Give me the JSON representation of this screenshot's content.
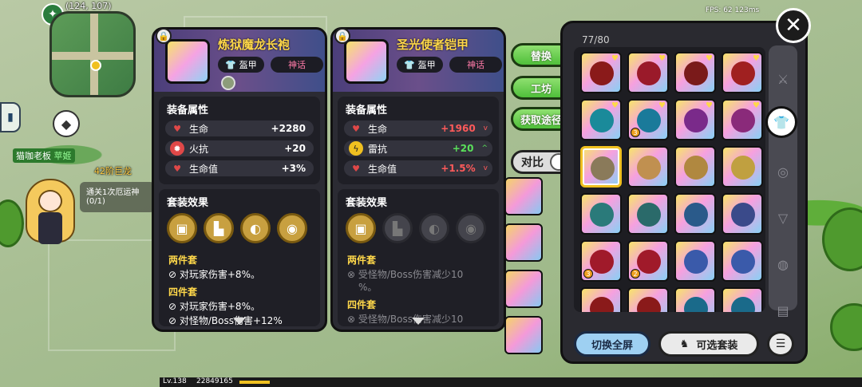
{
  "hud": {
    "coords": "(124, 107)",
    "fps": "FPS: 62 123ms",
    "level": "Lv.138",
    "xp": "22849165",
    "xp_fraction": 0.05
  },
  "world": {
    "npc_name": "猫咖老板",
    "npc_village": "苹姬",
    "boss_label": "42阶巨龙",
    "quest_title": "通关1次厄运神",
    "quest_progress": "(0/1)"
  },
  "left_card": {
    "title": "炼狱魔龙长袍",
    "type": "盔甲",
    "rarity": "神话",
    "level_badge": "6",
    "attr_title": "装备属性",
    "stats": [
      {
        "name": "生命",
        "value": "+2280",
        "icon": "heart-icon",
        "color": "#e04848"
      },
      {
        "name": "火抗",
        "value": "+20",
        "icon": "fire-resist-icon",
        "color": "#e04848"
      },
      {
        "name": "生命值",
        "value": "+3%",
        "icon": "heart-icon",
        "color": "#e04848"
      }
    ],
    "set_title": "套装效果",
    "set_two": "两件套",
    "set_two_effect": "对玩家伤害+8%。",
    "set_four": "四件套",
    "set_four_effect": "对玩家伤害+8%。",
    "set_four_effect2": "对怪物/Boss伤害+12%"
  },
  "right_card": {
    "title": "圣光使者铠甲",
    "type": "盔甲",
    "rarity": "神话",
    "attr_title": "装备属性",
    "stats": [
      {
        "name": "生命",
        "value": "+1960",
        "icon": "heart-icon",
        "color": "#e04848",
        "trend": "red",
        "arrow": "v"
      },
      {
        "name": "雷抗",
        "value": "+20",
        "icon": "thunder-resist-icon",
        "color": "#f0c020",
        "trend": "green",
        "arrow": "^"
      },
      {
        "name": "生命值",
        "value": "+1.5%",
        "icon": "heart-icon",
        "color": "#e04848",
        "trend": "red",
        "arrow": "v"
      }
    ],
    "set_title": "套装效果",
    "set_two": "两件套",
    "set_two_effect": "受怪物/Boss伤害减少10",
    "set_two_effect_cont": "%。",
    "set_four": "四件套",
    "set_four_effect": "受怪物/Boss伤害减少10"
  },
  "actions": {
    "replace": "替换",
    "workshop": "工坊",
    "obtain": "获取途径",
    "compare": "对比"
  },
  "inventory": {
    "count": "77/80",
    "fullscreen": "切换全屏",
    "suit_select": "可选套装",
    "rows": [
      [
        {
          "g": "#8a1a1a",
          "l": "",
          "s": true
        },
        {
          "g": "#9a1a2a",
          "l": "",
          "s": true
        },
        {
          "g": "#7a1a1a",
          "l": "",
          "s": true
        },
        {
          "g": "#a02020",
          "l": "",
          "s": true
        }
      ],
      [
        {
          "g": "#1a8a9a",
          "l": "",
          "s": true
        },
        {
          "g": "#1a7a9a",
          "l": "3",
          "s": true
        },
        {
          "g": "#7a2a8a",
          "l": "",
          "s": true
        },
        {
          "g": "#8a2a7a",
          "l": "",
          "s": true
        }
      ],
      [
        {
          "g": "#8a7a5a",
          "l": "",
          "s": false,
          "sel": true
        },
        {
          "g": "#c09050",
          "l": "",
          "s": false
        },
        {
          "g": "#b08840",
          "l": "",
          "s": false
        },
        {
          "g": "#c0a040",
          "l": "",
          "s": false
        }
      ],
      [
        {
          "g": "#2a7a7a",
          "l": "",
          "s": false
        },
        {
          "g": "#2a6a6a",
          "l": "",
          "s": false
        },
        {
          "g": "#2a5a8a",
          "l": "",
          "s": false
        },
        {
          "g": "#3a4a8a",
          "l": "",
          "s": false
        }
      ],
      [
        {
          "g": "#a01a2a",
          "l": "3",
          "s": false
        },
        {
          "g": "#a01a2a",
          "l": "2",
          "s": false
        },
        {
          "g": "#3a5aaa",
          "l": "",
          "s": false
        },
        {
          "g": "#3a5aaa",
          "l": "",
          "s": false
        }
      ],
      [
        {
          "g": "#8a1a1a",
          "l": "",
          "s": false
        },
        {
          "g": "#8a1a1a",
          "l": "",
          "s": false
        },
        {
          "g": "#1a6a8a",
          "l": "",
          "s": false
        },
        {
          "g": "#1a6a8a",
          "l": "",
          "s": false
        }
      ]
    ],
    "categories": [
      "weapon-icon",
      "armor-icon",
      "ring-icon",
      "amulet-icon",
      "bracelet-icon",
      "boots-icon"
    ]
  }
}
